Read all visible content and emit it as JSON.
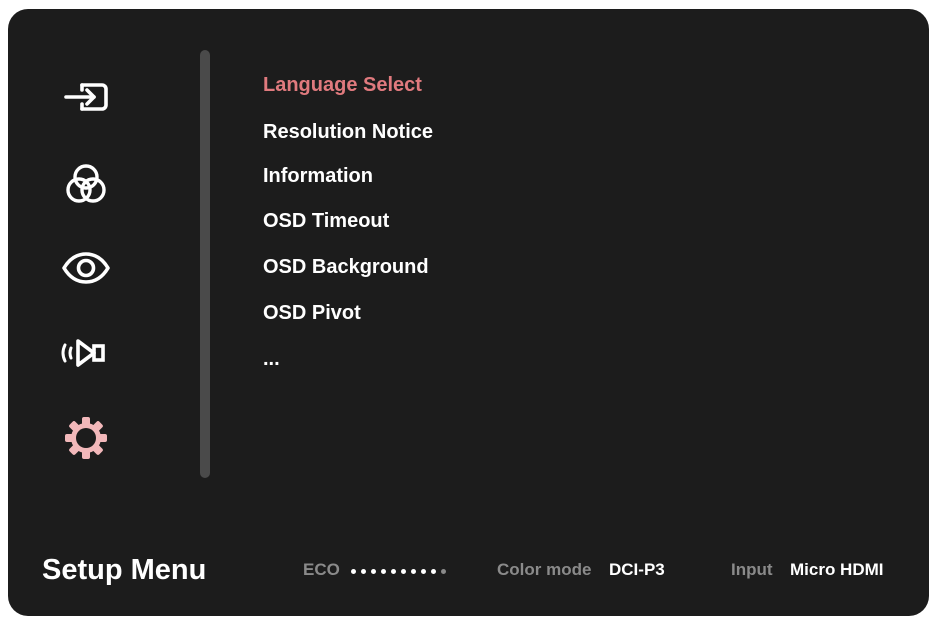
{
  "sidebar": {
    "icons": [
      {
        "name": "input-icon"
      },
      {
        "name": "color-icon"
      },
      {
        "name": "eye-icon"
      },
      {
        "name": "audio-icon"
      },
      {
        "name": "gear-icon",
        "active": true
      }
    ],
    "active_color": "#f2b8ba"
  },
  "menu": {
    "items": [
      {
        "label": "Language Select",
        "selected": true
      },
      {
        "label": "Resolution Notice"
      },
      {
        "label": "Information"
      },
      {
        "label": "OSD Timeout"
      },
      {
        "label": "OSD Background"
      },
      {
        "label": "OSD Pivot"
      },
      {
        "label": "..."
      }
    ],
    "selected_color": "#e07a7e"
  },
  "footer": {
    "title": "Setup Menu",
    "eco_label": "ECO",
    "eco_level": 9,
    "eco_max": 10,
    "color_mode_label": "Color mode",
    "color_mode_value": "DCI-P3",
    "input_label": "Input",
    "input_value": "Micro HDMI"
  }
}
